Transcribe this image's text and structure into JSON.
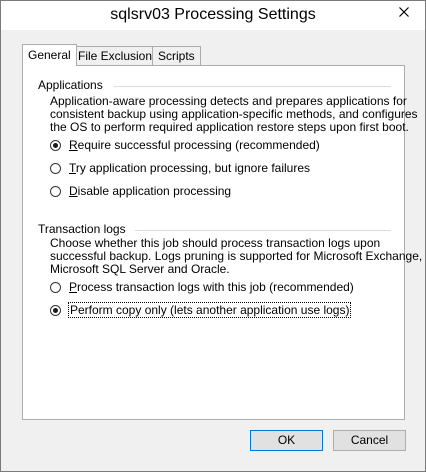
{
  "window": {
    "title": "sqlsrv03 Processing Settings"
  },
  "tabs": [
    {
      "label": "General",
      "active": true
    },
    {
      "label": "File Exclusions",
      "active": false
    },
    {
      "label": "Scripts",
      "active": false
    }
  ],
  "applications": {
    "heading": "Applications",
    "description_lines": [
      "Application-aware processing detects and prepares applications for",
      "consistent backup using application-specific methods, and configures",
      "the OS to perform required application restore steps upon first boot."
    ],
    "options": [
      {
        "accel": "R",
        "rest": "equire successful processing  (recommended)",
        "selected": true
      },
      {
        "accel": "T",
        "rest": "ry application processing, but ignore failures",
        "selected": false
      },
      {
        "accel": "D",
        "rest": "isable application processing",
        "selected": false
      }
    ]
  },
  "transaction_logs": {
    "heading": "Transaction logs",
    "description_lines": [
      "Choose whether this job should process transaction logs upon",
      "successful backup. Logs pruning is supported for Microsoft Exchange,",
      "Microsoft SQL Server and Oracle."
    ],
    "options": [
      {
        "accel": "P",
        "rest": "rocess transaction logs with this job (recommended)",
        "selected": false
      },
      {
        "accel": "",
        "rest": "Perform copy only (lets another application use logs)",
        "selected": true
      }
    ]
  },
  "buttons": {
    "ok": "OK",
    "cancel": "Cancel"
  },
  "colors": {
    "default_button_border": "#0078d7",
    "background": "#f0f0f0"
  }
}
